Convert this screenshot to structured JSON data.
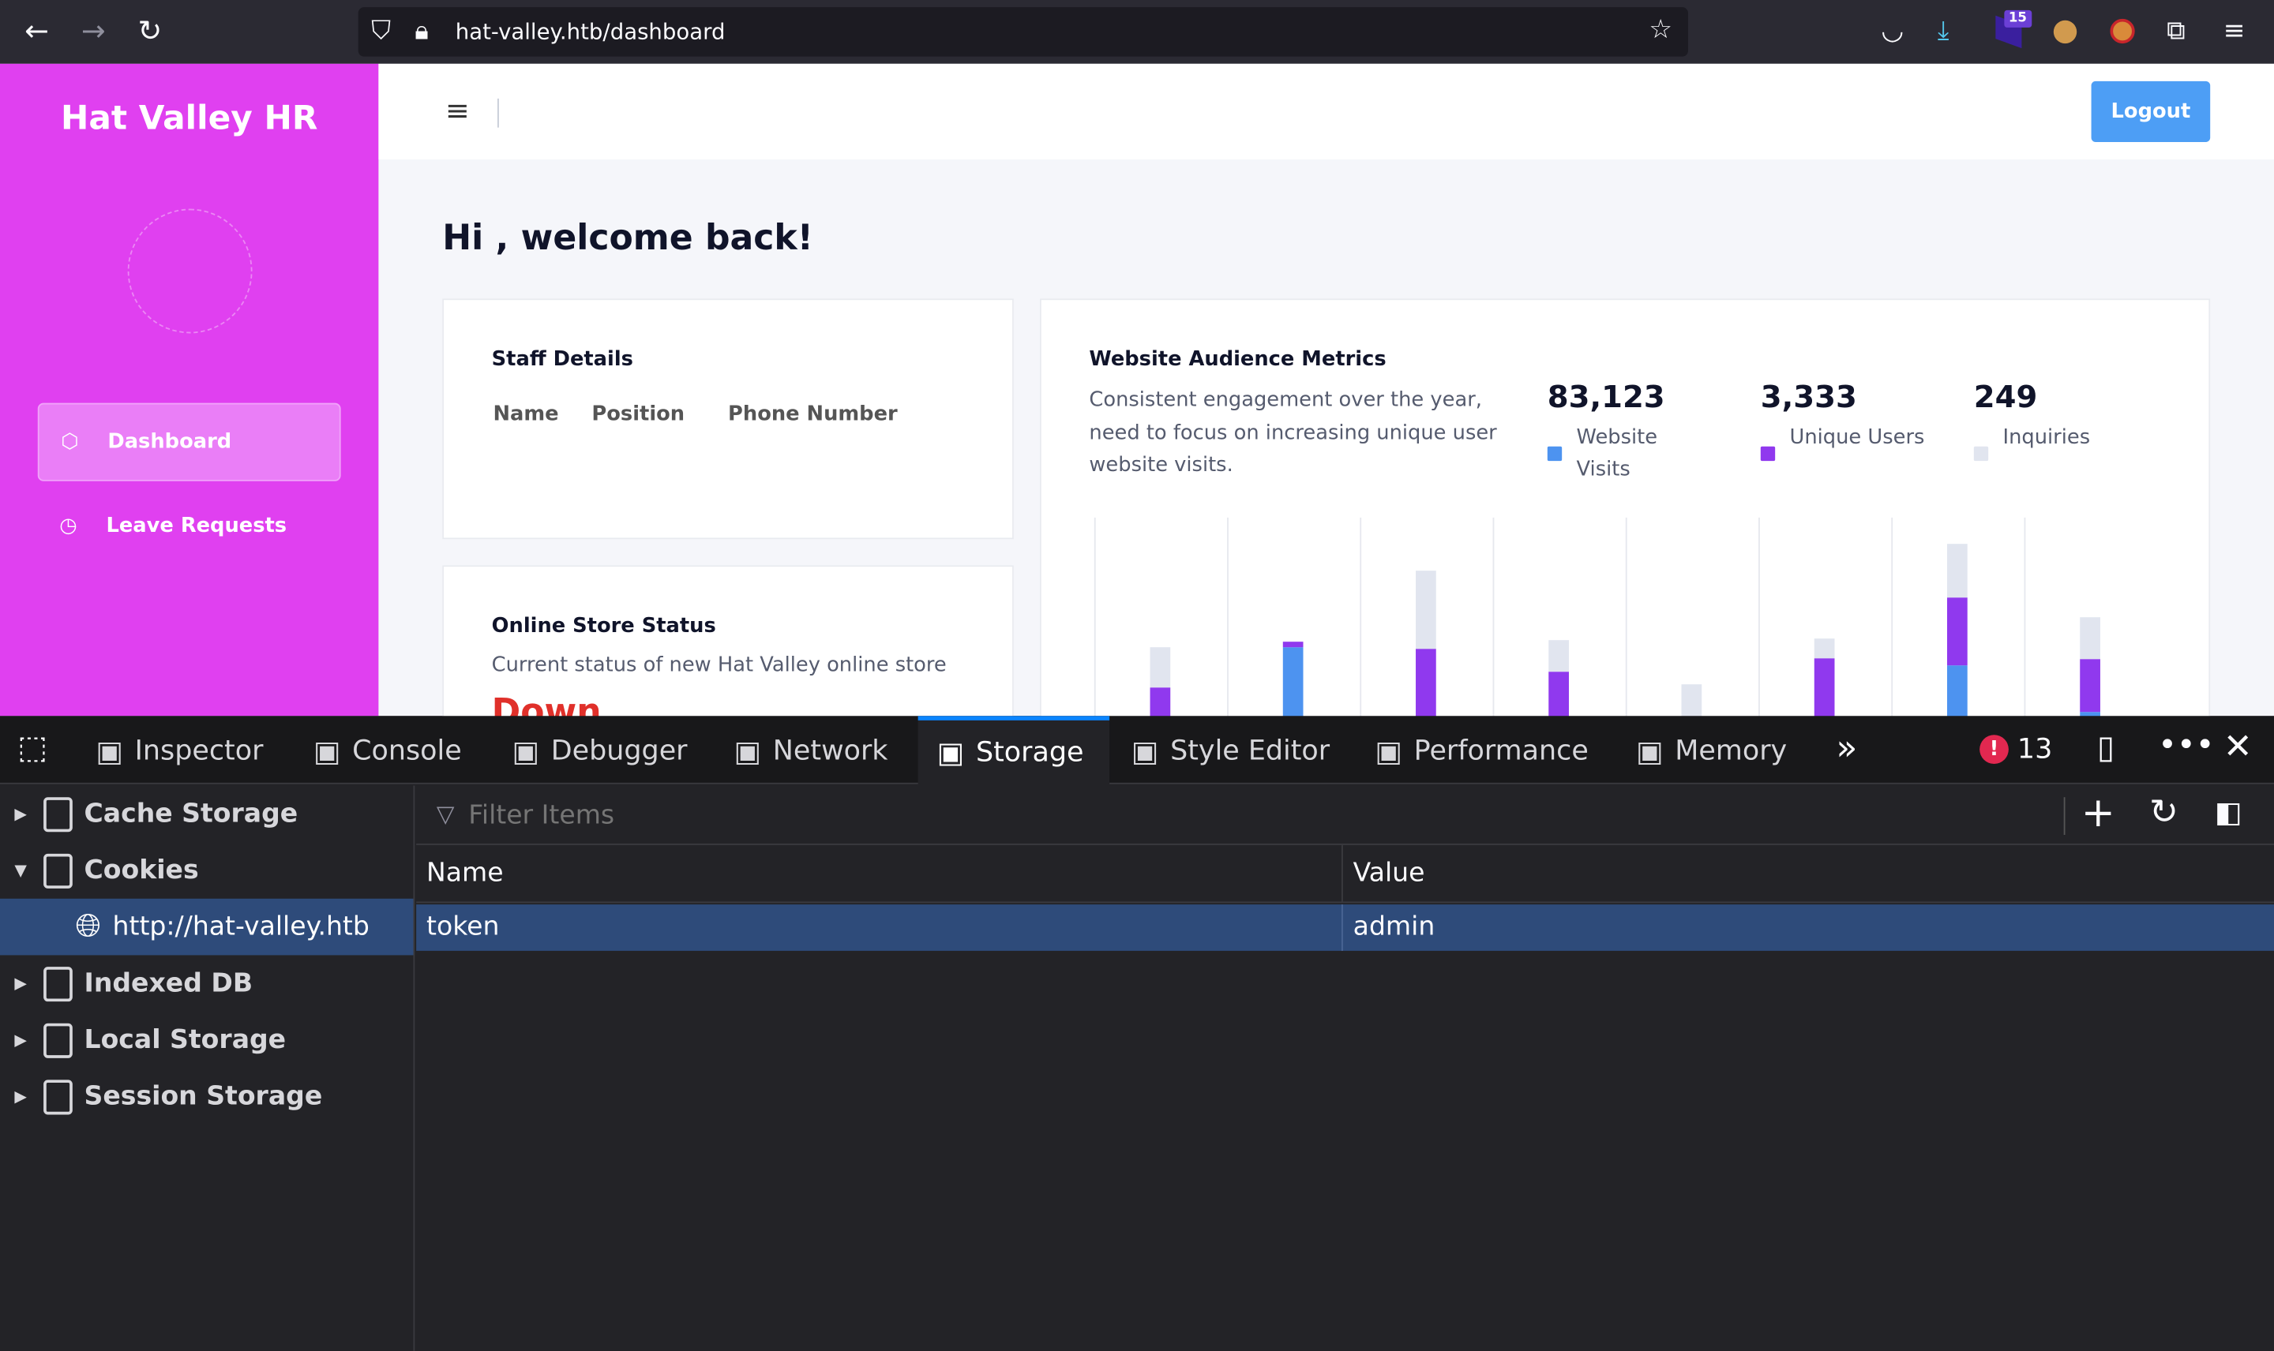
{
  "browser": {
    "url": "hat-valley.htb/dashboard",
    "extension_badge": "15"
  },
  "sidebar": {
    "brand": "Hat Valley HR",
    "items": [
      {
        "label": "Dashboard",
        "icon": "box-icon",
        "active": true
      },
      {
        "label": "Leave Requests",
        "icon": "clock-icon",
        "active": false
      }
    ]
  },
  "header": {
    "menu_icon": "hamburger-icon",
    "logout": "Logout"
  },
  "main": {
    "greeting": "Hi , welcome back!",
    "staff": {
      "title": "Staff Details",
      "columns": [
        "Name",
        "Position",
        "Phone Number"
      ]
    },
    "store": {
      "title": "Online Store Status",
      "subtitle": "Current status of new Hat Valley online store",
      "status": "Down"
    },
    "metrics": {
      "title": "Website Audience Metrics",
      "description": "Consistent engagement over the year, need to focus on increasing unique user website visits.",
      "stats": [
        {
          "value": "83,123",
          "label": "Website Visits",
          "color": "#4d93f0"
        },
        {
          "value": "3,333",
          "label": "Unique Users",
          "color": "#9039ee"
        },
        {
          "value": "249",
          "label": "Inquiries",
          "color": "#e1e5ef"
        }
      ]
    }
  },
  "chart_data": {
    "type": "bar",
    "stacked": true,
    "grid": "vertical",
    "title": "",
    "xlabel": "",
    "ylabel": "",
    "series": [
      {
        "name": "Website Visits",
        "color": "#4d93f0",
        "values": [
          0,
          89,
          0,
          0,
          0,
          0,
          66,
          7
        ]
      },
      {
        "name": "Unique Users",
        "color": "#9039ee",
        "values": [
          38,
          7,
          87,
          58,
          0,
          75,
          86,
          67
        ]
      },
      {
        "name": "Inquiries",
        "color": "#e1e5ef",
        "values": [
          51,
          0,
          99,
          40,
          42,
          25,
          68,
          53
        ]
      }
    ]
  },
  "devtools": {
    "tabs": [
      {
        "label": "Inspector",
        "icon": "inspector-icon"
      },
      {
        "label": "Console",
        "icon": "console-icon"
      },
      {
        "label": "Debugger",
        "icon": "debugger-icon"
      },
      {
        "label": "Network",
        "icon": "network-icon"
      },
      {
        "label": "Storage",
        "icon": "storage-icon",
        "selected": true
      },
      {
        "label": "Style Editor",
        "icon": "braces-icon"
      },
      {
        "label": "Performance",
        "icon": "gauge-icon"
      },
      {
        "label": "Memory",
        "icon": "chip-icon"
      }
    ],
    "error_count": "13",
    "filter_placeholder": "Filter Items",
    "tree": [
      {
        "label": "Cache Storage",
        "expanded": false
      },
      {
        "label": "Cookies",
        "expanded": true,
        "children": [
          "http://hat-valley.htb"
        ]
      },
      {
        "label": "Indexed DB",
        "expanded": false
      },
      {
        "label": "Local Storage",
        "expanded": false
      },
      {
        "label": "Session Storage",
        "expanded": false
      }
    ],
    "table": {
      "columns": [
        "Name",
        "Value"
      ],
      "rows": [
        [
          "token",
          "admin"
        ]
      ]
    }
  }
}
